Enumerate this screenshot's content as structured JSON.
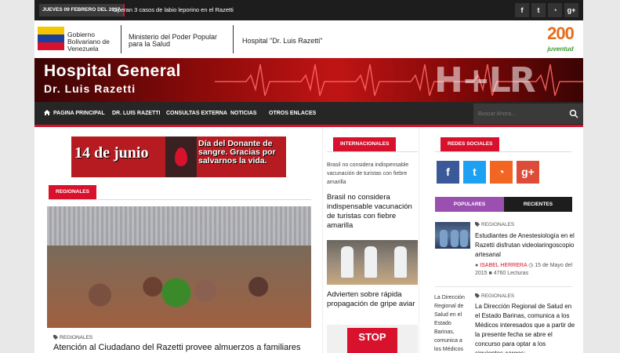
{
  "topbar": {
    "date": "JUEVES 09 FEBRERO DEL 2017",
    "ticker": "Operan 3 casos de labio leporino en el Razetti",
    "social": [
      {
        "icon": "facebook-icon",
        "glyph": "f"
      },
      {
        "icon": "twitter-icon",
        "glyph": "t"
      },
      {
        "icon": "rss-icon",
        "glyph": "◔"
      },
      {
        "icon": "google-plus-icon",
        "glyph": "g+"
      }
    ]
  },
  "gov": {
    "line1": "Gobierno Bolivariano de Venezuela",
    "ministry": "Ministerio del Poder Popular para la Salud",
    "hospital": "Hospital \"Dr. Luis Razetti\"",
    "logo_num": "200",
    "logo_sub": "juventud"
  },
  "banner": {
    "title": "Hospital General",
    "subtitle": "Dr. Luis Razetti",
    "logo": "H+LR"
  },
  "nav": {
    "items": [
      {
        "label": "PAGINA PRINCIPAL"
      },
      {
        "label": "DR. LUIS RAZETTI"
      },
      {
        "label": "CONSULTAS EXTERNA"
      },
      {
        "label": "NOTICIAS"
      },
      {
        "label": "OTROS ENLACES"
      }
    ],
    "search_placeholder": "Buscar Ahora..."
  },
  "ad": {
    "date": "14 de junio",
    "text": "Día del Donante de sangre. Gracias por salvarnos la vida."
  },
  "main": {
    "section": "REGIONALES",
    "category": "REGIONALES",
    "headline": "Atención al Ciudadano del Razetti provee almuerzos a familiares de"
  },
  "middle": {
    "section": "INTERNACIONALES",
    "summary": "Brasil no considera indispensable vacunación de turistas con fiebre amarilla",
    "headline1": "Brasil no considera indispensable vacunación de turistas con fiebre amarilla",
    "headline2": "Advierten sobre rápida propagación de gripe aviar",
    "stop": "STOP"
  },
  "right": {
    "section": "REDES SOCIALES",
    "social": [
      {
        "icon": "facebook-icon",
        "glyph": "f",
        "color": "#3b5998"
      },
      {
        "icon": "twitter-icon",
        "glyph": "t",
        "color": "#1da1f2"
      },
      {
        "icon": "rss-icon",
        "glyph": "◔",
        "color": "#f26522"
      },
      {
        "icon": "google-plus-icon",
        "glyph": "g+",
        "color": "#dd4b39"
      }
    ],
    "tab_popular": "POPULARES",
    "tab_recent": "RECIENTES",
    "post1": {
      "category": "REGIONALES",
      "title": "Estudiantes de Anestesiología en el Razetti disfrutan videolaringoscopio artesanal",
      "author": "ISABEL HERRERA",
      "date": "15 de Mayo del 2015",
      "reads": "4760 Lecturas"
    },
    "post2": {
      "category": "REGIONALES",
      "title": "La Dirección Regional de Salud en el Estado Barinas, comunica a los Médicos interesados que a partir de la presente fecha se abre el concurso para optar a los siguientes cargos:"
    },
    "narrow": "La Dirección Regional de Salud en el Estado Barinas, comunica a los Médicos"
  },
  "colors": {
    "accent": "#d8112d",
    "dark": "#262626",
    "popular_tab": "#9b4fb0",
    "recent_tab": "#1d1d1d"
  }
}
